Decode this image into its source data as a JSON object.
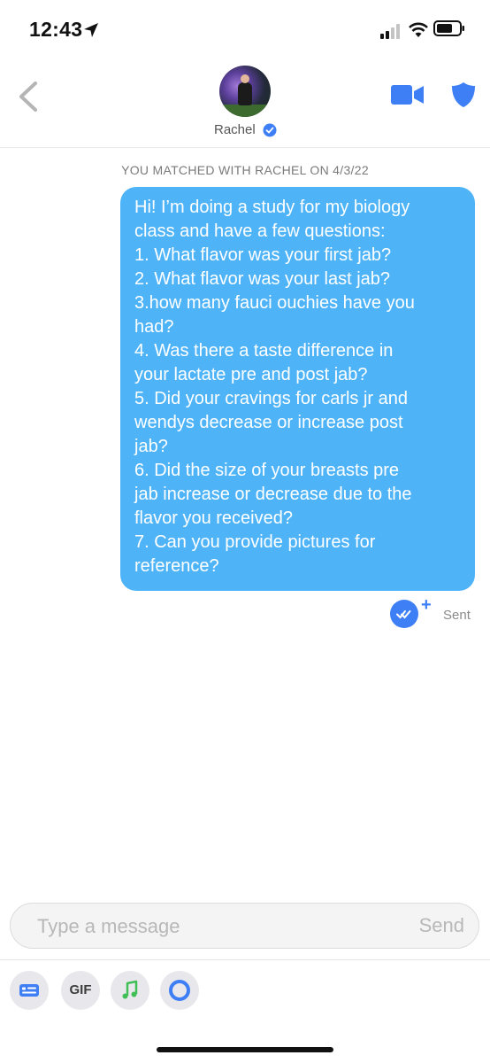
{
  "status_bar": {
    "time": "12:43",
    "icons": [
      "location-arrow-icon",
      "signal-bars-icon",
      "wifi-icon",
      "battery-icon"
    ]
  },
  "header": {
    "back_icon": "chevron-left-icon",
    "match_name": "Rachel",
    "verified_icon": "verified-check-icon",
    "video_icon": "video-camera-icon",
    "safety_icon": "shield-icon"
  },
  "conversation": {
    "matched_banner": "YOU MATCHED WITH RACHEL ON 4/3/22",
    "messages": [
      {
        "from": "me",
        "lines": [
          "Hi! I’m doing a study for my biology",
          "class and have a few questions:",
          "1. What flavor was your first jab?",
          "2. What flavor was your last jab?",
          "3.how many fauci ouchies have you",
          "had?",
          "4. Was there a taste difference in",
          "your lactate pre and post jab?",
          "5. Did your cravings for carls jr and",
          "wendys decrease or increase post",
          "jab?",
          "6. Did the size of your breasts pre",
          "jab increase or decrease due to the",
          "flavor you received?",
          "7. Can you provide pictures for",
          "reference?"
        ],
        "status": "Sent",
        "read_receipt_icon": "double-check-icon",
        "plus_icon": "+"
      }
    ]
  },
  "composer": {
    "placeholder": "Type a message",
    "value": "",
    "send_label": "Send"
  },
  "toolbar": {
    "items": [
      {
        "name": "sticker-card-icon"
      },
      {
        "name": "gif-button",
        "label": "GIF"
      },
      {
        "name": "music-note-icon"
      },
      {
        "name": "loop-circle-icon"
      }
    ]
  },
  "colors": {
    "bubble": "#4fb4f7",
    "accent_blue": "#3f7ff5",
    "music_green": "#3fbf55",
    "muted_text": "#7a7a7a"
  }
}
